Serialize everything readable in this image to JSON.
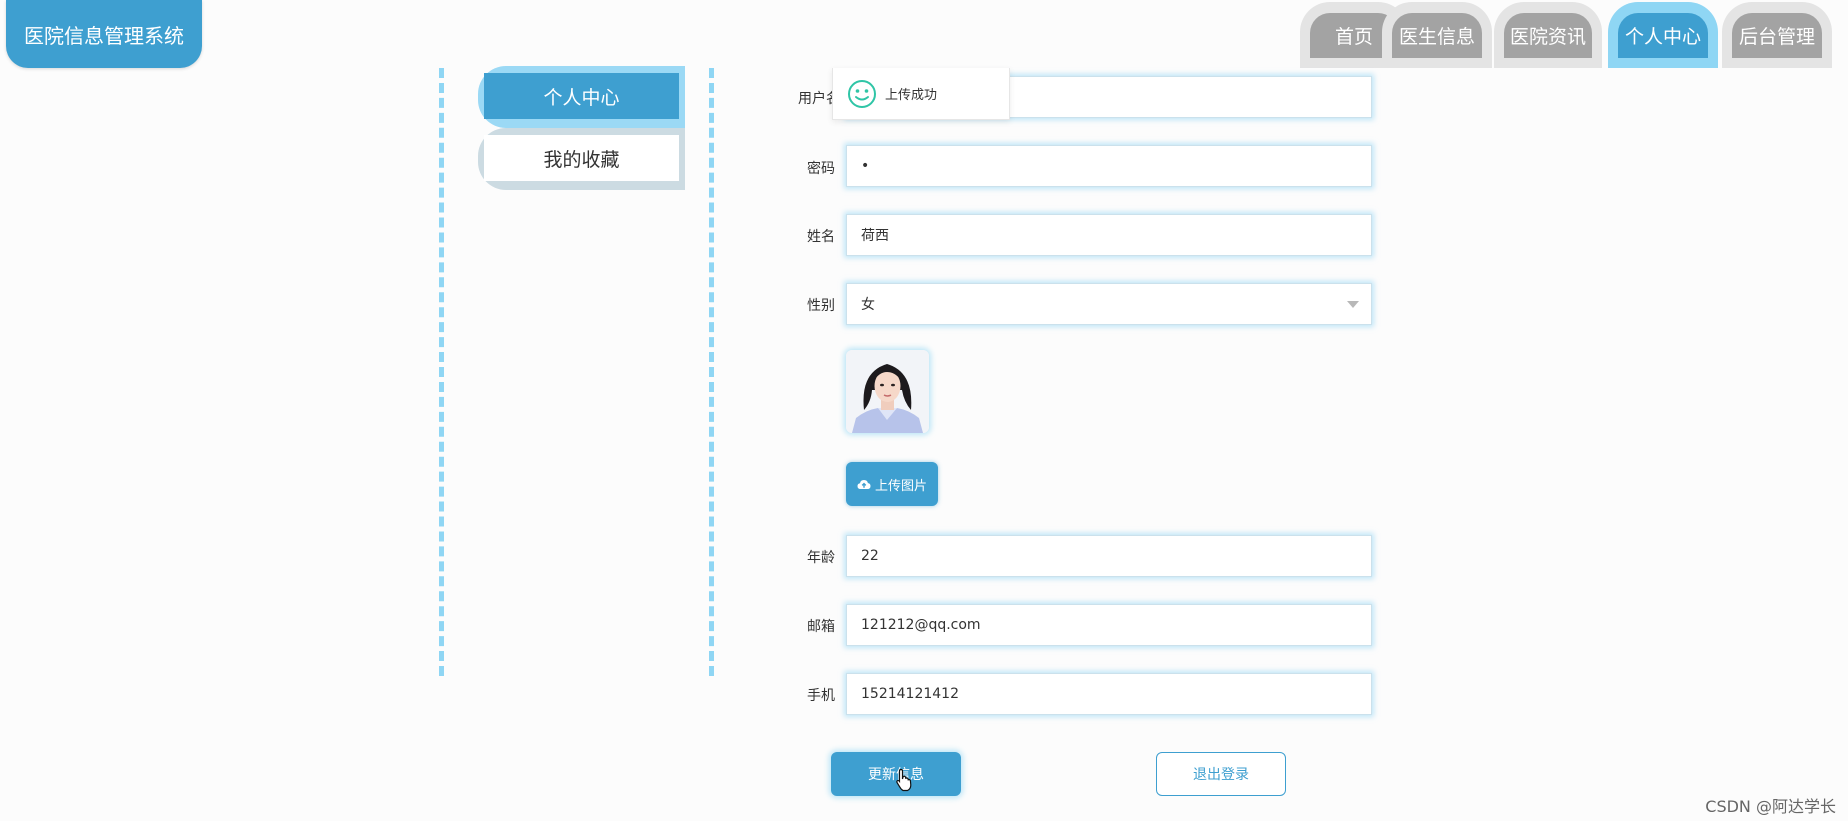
{
  "app": {
    "title": "医院信息管理系统"
  },
  "nav": {
    "tabs": [
      {
        "label": "首页",
        "active": false
      },
      {
        "label": "医生信息",
        "active": false
      },
      {
        "label": "医院资讯",
        "active": false
      },
      {
        "label": "个人中心",
        "active": true
      },
      {
        "label": "后台管理",
        "active": false
      }
    ]
  },
  "sidebar": {
    "items": [
      {
        "label": "个人中心",
        "active": true
      },
      {
        "label": "我的收藏",
        "active": false
      }
    ]
  },
  "form": {
    "username": {
      "label": "用户名",
      "value": ""
    },
    "password": {
      "label": "密码",
      "value": "•"
    },
    "name": {
      "label": "姓名",
      "value": "荷西"
    },
    "gender": {
      "label": "性别",
      "value": "女"
    },
    "upload_label": "上传图片",
    "age": {
      "label": "年龄",
      "value": "22"
    },
    "email": {
      "label": "邮箱",
      "value": "121212@qq.com"
    },
    "phone": {
      "label": "手机",
      "value": "15214121412"
    }
  },
  "actions": {
    "update_label": "更新信息",
    "logout_label": "退出登录"
  },
  "toast": {
    "message": "上传成功"
  },
  "watermark": "CSDN @阿达学长",
  "colors": {
    "primary": "#3e9fd0",
    "accent_light": "#8fd6f4",
    "tab_inactive": "#a3a3a3"
  }
}
